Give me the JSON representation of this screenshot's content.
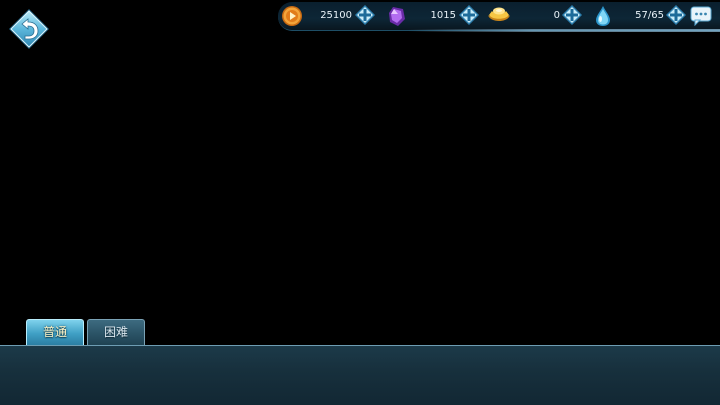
{
  "colors": {
    "background": "#000000",
    "bar": "#0d2636",
    "panel": "#17303d",
    "tab_active": "#3f9fc4",
    "tab_inactive": "#2b5366",
    "plus_frame": "#4aa7d6"
  },
  "topbar": {
    "resources": [
      {
        "icon": "gold-coin-icon",
        "value": "25100"
      },
      {
        "icon": "purple-crystal-icon",
        "value": "1015"
      },
      {
        "icon": "gold-ingot-icon",
        "value": "0"
      },
      {
        "icon": "stamina-drop-icon",
        "value": "57/65"
      }
    ]
  },
  "tabs": [
    {
      "label": "普通",
      "active": true
    },
    {
      "label": "困难",
      "active": false
    }
  ]
}
